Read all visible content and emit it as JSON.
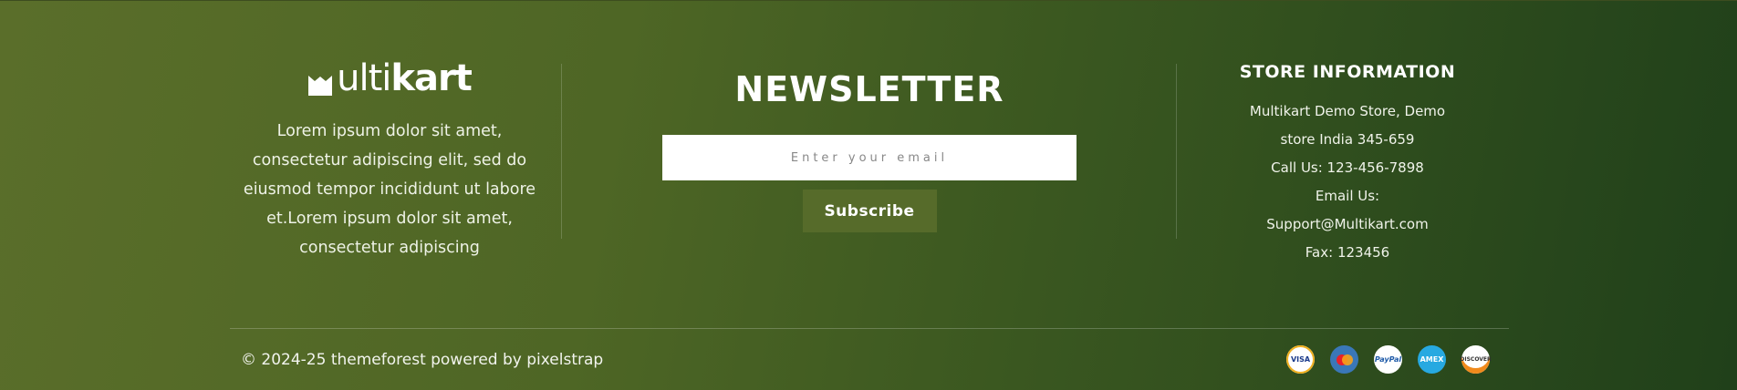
{
  "about": {
    "logo_text_light": "ul",
    "logo_text_mid": "ti",
    "logo_text_bold": "kart",
    "description": "Lorem ipsum dolor sit amet, consectetur adipiscing elit, sed do eiusmod tempor incididunt ut labore et.Lorem ipsum dolor sit amet, consectetur adipiscing"
  },
  "newsletter": {
    "title": "NEWSLETTER",
    "email_placeholder": "Enter your email",
    "subscribe_label": "Subscribe"
  },
  "store": {
    "title": "STORE INFORMATION",
    "lines": [
      "Multikart Demo Store, Demo",
      "store India 345-659",
      "Call Us: 123-456-7898",
      "Email Us:",
      "Support@Multikart.com",
      "Fax: 123456"
    ]
  },
  "footer_bottom": {
    "copyright": "© 2024-25 themeforest powered by pixelstrap",
    "payments": [
      {
        "name": "visa-icon",
        "label": "VISA"
      },
      {
        "name": "mastercard-icon",
        "label": ""
      },
      {
        "name": "paypal-icon",
        "label": "PayPal"
      },
      {
        "name": "amex-icon",
        "label": "AMEX"
      },
      {
        "name": "discover-icon",
        "label": "DISCOVER"
      }
    ]
  },
  "colors": {
    "gradient_start": "#5a6e2a",
    "gradient_end": "#20401a",
    "button_bg": "#566b2a"
  }
}
